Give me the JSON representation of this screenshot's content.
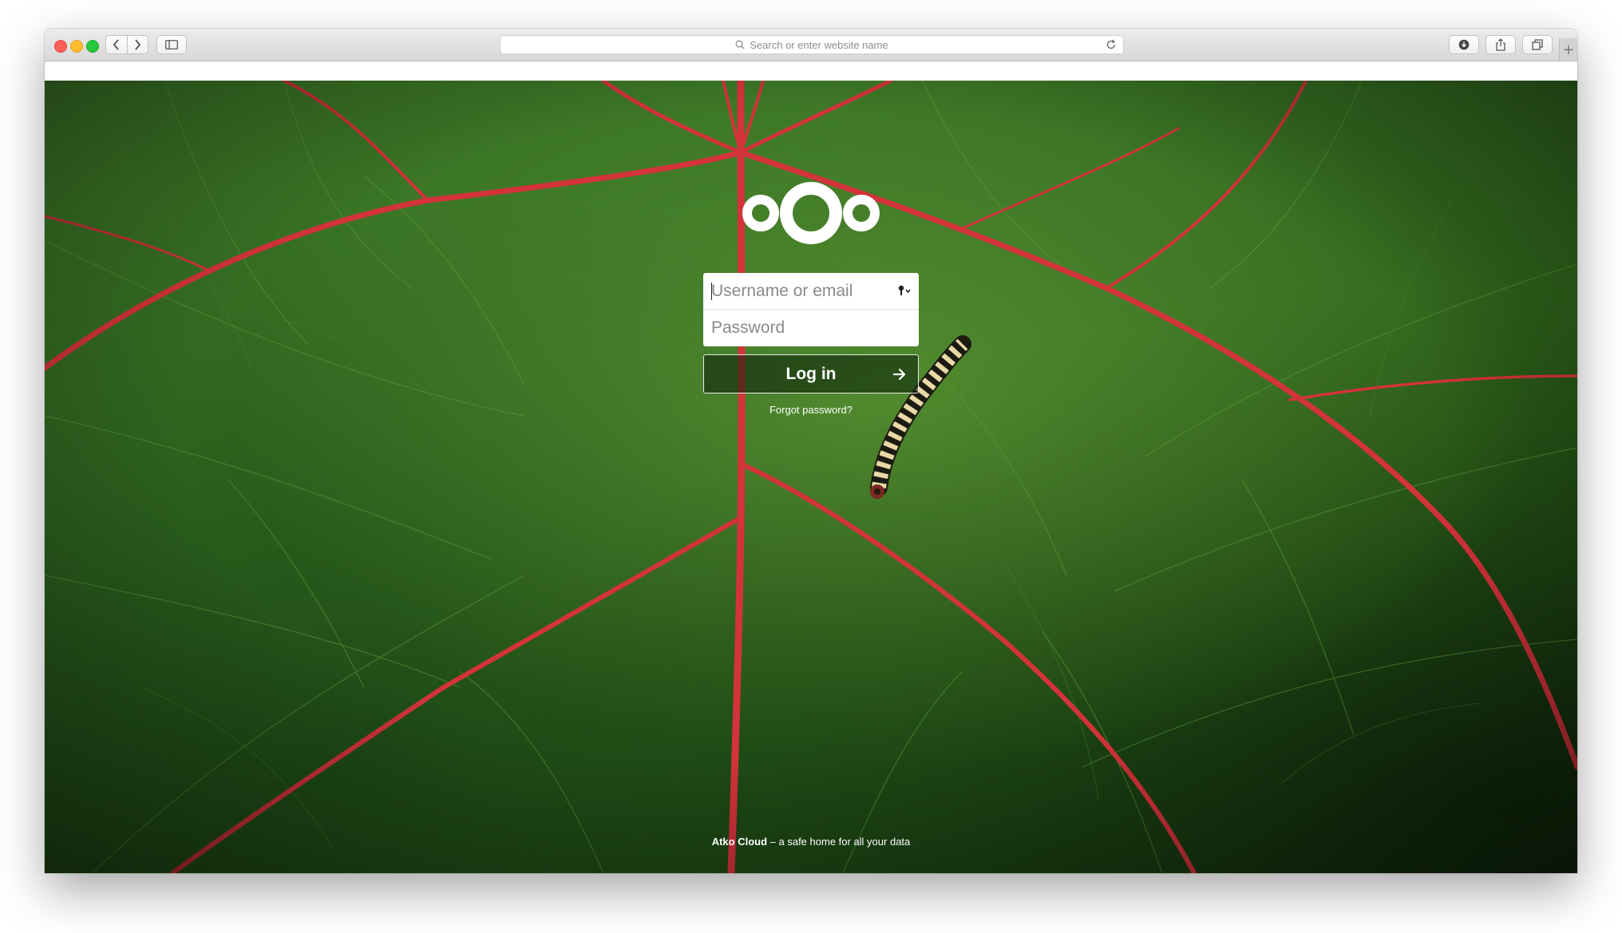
{
  "browser": {
    "address_placeholder": "Search or enter website name",
    "icons": [
      "back-icon",
      "forward-icon",
      "sidebar-icon",
      "search-icon",
      "reload-icon",
      "download-icon",
      "share-icon",
      "tabs-icon",
      "new-tab-icon"
    ]
  },
  "login": {
    "username_placeholder": "Username or email",
    "password_placeholder": "Password",
    "login_label": "Log in",
    "forgot_label": "Forgot password?"
  },
  "footer": {
    "brand": "Atko Cloud",
    "tagline": " – a safe home for all your data"
  },
  "colors": {
    "leaf_green": "#356e22",
    "vein_red": "#d9363e"
  }
}
